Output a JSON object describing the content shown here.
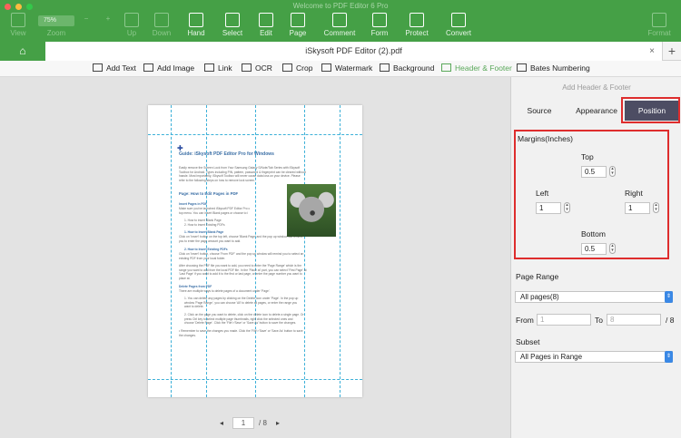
{
  "window": {
    "title": "Welcome to PDF Editor 6 Pro",
    "traffic_colors": [
      "#fc605c",
      "#fdbc40",
      "#34c84a"
    ]
  },
  "toolbar": {
    "zoom_value": "75%",
    "items": [
      {
        "label": "View",
        "icon": "view-icon",
        "dim": true
      },
      {
        "label": "Zoom",
        "icon": "zoom-icon",
        "dim": true
      },
      {
        "label": "Up",
        "icon": "up-icon",
        "dim": true
      },
      {
        "label": "Down",
        "icon": "down-icon",
        "dim": true
      },
      {
        "label": "Hand",
        "icon": "hand-icon",
        "dim": false
      },
      {
        "label": "Select",
        "icon": "select-icon",
        "dim": false
      },
      {
        "label": "Edit",
        "icon": "edit-icon",
        "dim": false
      },
      {
        "label": "Page",
        "icon": "page-icon",
        "dim": false
      },
      {
        "label": "Comment",
        "icon": "comment-icon",
        "dim": false
      },
      {
        "label": "Form",
        "icon": "form-icon",
        "dim": false
      },
      {
        "label": "Protect",
        "icon": "protect-icon",
        "dim": false
      },
      {
        "label": "Convert",
        "icon": "convert-icon",
        "dim": false
      },
      {
        "label": "Format",
        "icon": "format-icon",
        "dim": true
      }
    ]
  },
  "tabs": {
    "home_icon": "home-icon",
    "document": "iSkysoft PDF Editor (2).pdf",
    "close": "×",
    "add": "+"
  },
  "edit_toolbar": [
    {
      "label": "Add Text",
      "icon": "add-text-icon"
    },
    {
      "label": "Add Image",
      "icon": "add-image-icon"
    },
    {
      "label": "Link",
      "icon": "link-icon"
    },
    {
      "label": "OCR",
      "icon": "ocr-icon"
    },
    {
      "label": "Crop",
      "icon": "crop-icon"
    },
    {
      "label": "Watermark",
      "icon": "watermark-icon"
    },
    {
      "label": "Background",
      "icon": "background-icon"
    },
    {
      "label": "Header & Footer",
      "icon": "header-footer-icon",
      "active": true
    },
    {
      "label": "Bates Numbering",
      "icon": "bates-numbering-icon"
    }
  ],
  "document": {
    "title": "Guide: iSkysoft PDF Editor Pro for Windows",
    "intro": [
      "Easily remove the Screen Lock from Your Samsung Galaxy S/Note/Tab Series with iSkysoft",
      "Toolbox for Android. Types including PIN, pattern, password & fingerprint can be cleared without",
      "hassle. Most importantly, iSkysoft Toolbox will never cause data loss on your device. Please",
      "refer to the following steps on how to remove lock screen."
    ],
    "section1": "Page:  How to Edit Pages in PDF",
    "insert_heading": "Insert Pages in PDF",
    "insert_text": [
      "Make sure you've launched iSkysoft PDF Editor Pro c",
      "top menu. You can insert Blank pages or choose to i"
    ],
    "insert_items": [
      "1.   How to insert Blank Page",
      "2.   How to insert Existing PDFs"
    ],
    "blank_heading": "1.   How to Insert Blank Page",
    "blank_text": [
      "Click on 'Insert' button on the top left, choose 'Blank Page' and the pop up window will remind",
      "you to enter the page amount you want to add."
    ],
    "existing_heading": "2.   How to Insert Existing PDFs",
    "existing_text": [
      "Click on 'Insert' button, choose 'From PDF' and the pop up window will remind you to select an",
      "existing PDF from your local folder.",
      "",
      "After choosing the PDF file you want to add, you need to enter the 'Page Range' which is the",
      "range you want to add from the local PDF file. In the 'Place at' part, you can select 'First Page' at",
      "'Last Page' if you want to add it to the first or last page, or enter the page number you want to",
      "place at."
    ],
    "delete_heading": "Delete Pages from PDF",
    "delete_text": [
      "There are multiple ways to delete pages of a document under 'Page'.",
      "",
      "1.   You can delete any pages by clicking on the Delete icon under 'Page'. In the pop up",
      "      window 'Page Range', you can choose 'All' to delete all pages, or enter the range you",
      "      want to delete.",
      "",
      "2.   Click on the page you want to delete, click on the delete icon to delete a single page. Or",
      "      press Ctrl key to select multiple page thumbnails, right click the selected ones and",
      "      choose 'Delete Page'. Click the 'File'>'Save' or 'Save As' button to save the changes.",
      "",
      "•   Remember to save the changes you made. Click the 'File'>'Save' or 'Save As' button to save",
      "     the changes."
    ]
  },
  "pager": {
    "prev": "◂",
    "current": "1",
    "total": "/ 8",
    "next": "▸"
  },
  "panel": {
    "header": "Add Header & Footer",
    "tabs": [
      "Source",
      "Appearance",
      "Position"
    ],
    "active_tab": "Position",
    "highlight_color": "#de2d2d",
    "margins": {
      "label": "Margins(Inches)",
      "top_label": "Top",
      "top": "0.5",
      "left_label": "Left",
      "left": "1",
      "right_label": "Right",
      "right": "1",
      "bottom_label": "Bottom",
      "bottom": "0.5"
    },
    "page_range": {
      "label": "Page Range",
      "value": "All pages(8)",
      "from_label": "From",
      "from": "1",
      "to_label": "To",
      "to": "8",
      "total": "/ 8"
    },
    "subset": {
      "label": "Subset",
      "value": "All Pages in Range"
    }
  }
}
